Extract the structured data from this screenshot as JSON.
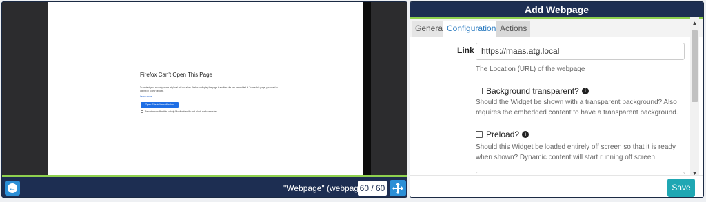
{
  "preview": {
    "widget_name": "\"Webpage\" (webpage)",
    "counter": "60 / 60",
    "embedded_page": {
      "title": "Firefox Can't Open This Page",
      "message": "To protect your security, maas.atg.local will not allow Firefox to display the page if another site has embedded it. To see this page, you need to open it in a new window.",
      "learn_more": "Learn more…",
      "button_label": "Open Site in New Window",
      "report_checkbox": "Report errors like this to help Mozilla identify and block malicious sites"
    }
  },
  "dialog": {
    "title": "Add Webpage",
    "tabs": [
      {
        "label": "General"
      },
      {
        "label": "Configuration"
      },
      {
        "label": "Actions"
      }
    ],
    "link": {
      "label": "Link",
      "value": "https://maas.atg.local",
      "help": "The Location (URL) of the webpage"
    },
    "background_transparent": {
      "label": "Background transparent?",
      "checked": false,
      "help": "Should the Widget be shown with a transparent background? Also requires the embedded content to have a transparent background."
    },
    "preload": {
      "label": "Preload?",
      "checked": false,
      "help": "Should this Widget be loaded entirely off screen so that it is ready when shown? Dynamic content will start running off screen."
    },
    "save_label": "Save"
  },
  "colors": {
    "header": "#1d2e52",
    "accent_green": "#8fd14f",
    "button_blue": "#2b8fd6",
    "save_teal": "#1fa7b3"
  }
}
